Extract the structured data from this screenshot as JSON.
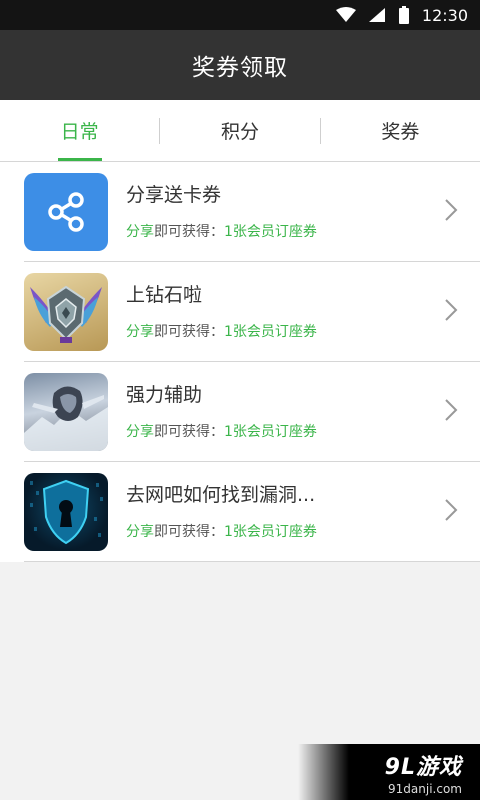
{
  "status_bar": {
    "time": "12:30",
    "icons": [
      "wifi-icon",
      "signal-icon",
      "battery-icon"
    ]
  },
  "header": {
    "title": "奖券领取"
  },
  "tabs": [
    {
      "label": "日常",
      "active": true
    },
    {
      "label": "积分",
      "active": false
    },
    {
      "label": "奖券",
      "active": false
    }
  ],
  "items": [
    {
      "title": "分享送卡券",
      "reward_prefix": "分享",
      "reward_mid": "即可获得：",
      "reward_value": "1张会员订座券",
      "thumb": "share-icon"
    },
    {
      "title": "上钻石啦",
      "reward_prefix": "分享",
      "reward_mid": "即可获得：",
      "reward_value": "1张会员订座券",
      "thumb": "diamond-badge-image"
    },
    {
      "title": "强力辅助",
      "reward_prefix": "分享",
      "reward_mid": "即可获得：",
      "reward_value": "1张会员订座券",
      "thumb": "warrior-image"
    },
    {
      "title": "去网吧如何找到漏洞...",
      "reward_prefix": "分享",
      "reward_mid": "即可获得：",
      "reward_value": "1张会员订座券",
      "thumb": "security-shield-image"
    }
  ],
  "watermark": {
    "brand": "9L游戏",
    "site": "91danji.com"
  },
  "colors": {
    "accent": "#3bb54a",
    "header_bg": "#333333",
    "status_bg": "#141414"
  }
}
